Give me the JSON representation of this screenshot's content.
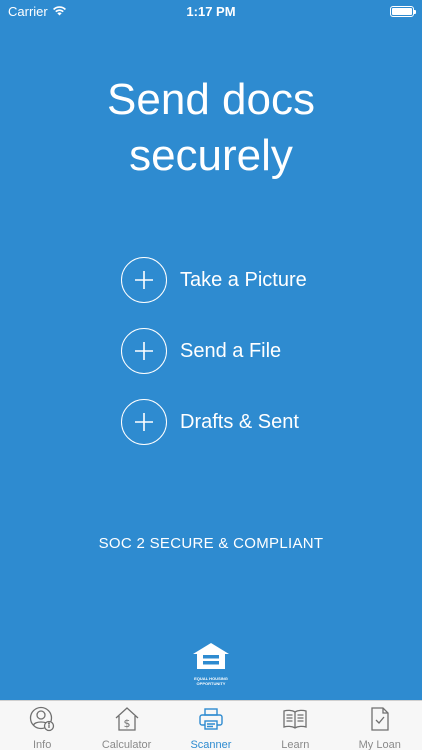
{
  "status_bar": {
    "carrier": "Carrier",
    "time": "1:17 PM"
  },
  "headline": {
    "line1": "Send docs",
    "line2": "securely"
  },
  "actions": [
    {
      "label": "Take a Picture",
      "icon": "plus-icon"
    },
    {
      "label": "Send a File",
      "icon": "plus-icon"
    },
    {
      "label": "Drafts & Sent",
      "icon": "plus-icon"
    }
  ],
  "compliance": "SOC 2 SECURE & COMPLIANT",
  "footer_logo": {
    "line1": "EQUAL HOUSING",
    "line2": "OPPORTUNITY",
    "icon": "equal-housing-icon"
  },
  "tabs": [
    {
      "label": "Info",
      "icon": "info-person-icon",
      "active": false
    },
    {
      "label": "Calculator",
      "icon": "calculator-house-icon",
      "active": false
    },
    {
      "label": "Scanner",
      "icon": "printer-icon",
      "active": true
    },
    {
      "label": "Learn",
      "icon": "book-icon",
      "active": false
    },
    {
      "label": "My Loan",
      "icon": "document-check-icon",
      "active": false
    }
  ],
  "colors": {
    "background": "#2e8bd0",
    "tabbar": "#f7f7f7",
    "tab_inactive": "#8a8a8a",
    "tab_active": "#2e8bd0"
  }
}
